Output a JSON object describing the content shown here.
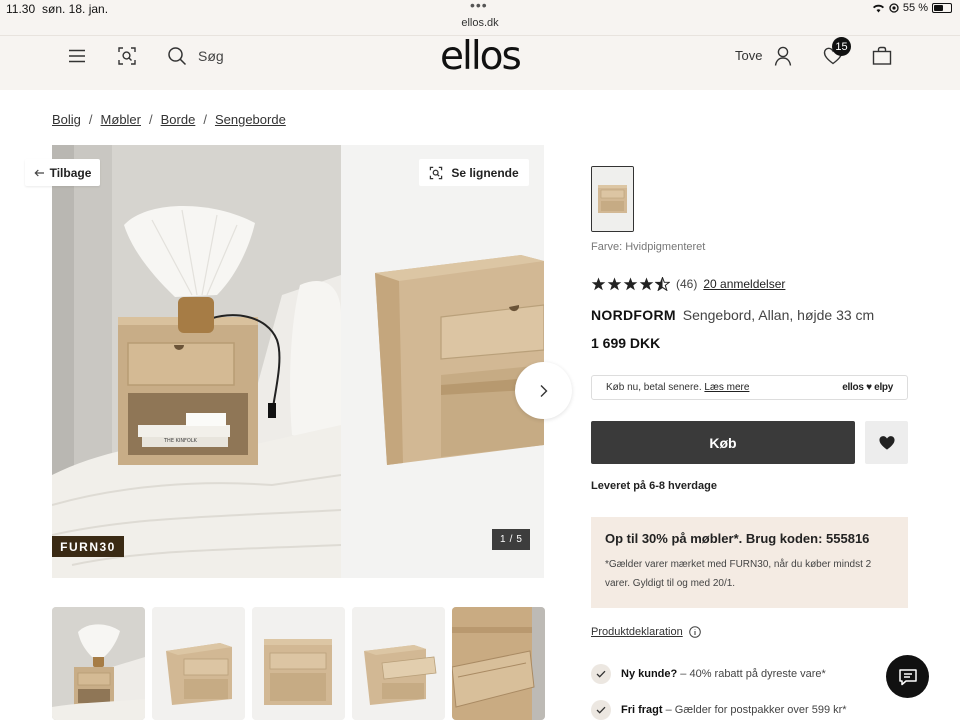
{
  "status_bar": {
    "time": "11.30",
    "date": "søn. 18. jan.",
    "url": "ellos.dk",
    "battery": "55 %",
    "battery_level": 0.55
  },
  "header": {
    "search_label": "Søg",
    "logo": "ellos",
    "user_name": "Tove",
    "wishlist_count": "15",
    "icons": [
      "menu-icon",
      "visual-search-icon",
      "search-icon",
      "user-icon",
      "heart-icon",
      "bag-icon"
    ]
  },
  "breadcrumb": [
    "Bolig",
    "Møbler",
    "Borde",
    "Sengeborde"
  ],
  "gallery": {
    "back_label": "Tilbage",
    "similar_label": "Se lignende",
    "promo_tag": "FURN30",
    "counter_current": "1",
    "counter_total": "5",
    "book_text": "THE KINFOLK"
  },
  "product": {
    "color_label": "Farve: Hvidpigmenteret",
    "rating": 4.5,
    "rating_count": "(46)",
    "reviews_link": "20 anmeldelser",
    "brand": "NORDFORM",
    "name": "Sengebord, Allan, højde 33 cm",
    "price": "1 699 DKK",
    "klarna_text": "Køb nu, betal senere.",
    "klarna_link": "Læs mere",
    "klarna_logo": "ellos ♥ elpy",
    "buy_label": "Køb",
    "delivery": "Leveret på 6-8 hverdage",
    "promo_head": "Op til 30% på møbler*. Brug koden: 555816",
    "promo_text": "*Gælder varer mærket med FURN30, når du køber mindst 2 varer. Gyldigt til og med 20/1.",
    "declaration_link": "Produktdeklaration",
    "benefits": [
      {
        "bold": "Ny kunde?",
        "text": " – 40% rabatt på dyreste vare*"
      },
      {
        "bold": "Fri fragt",
        "text": " – Gælder for postpakker over 599 kr*"
      }
    ]
  }
}
